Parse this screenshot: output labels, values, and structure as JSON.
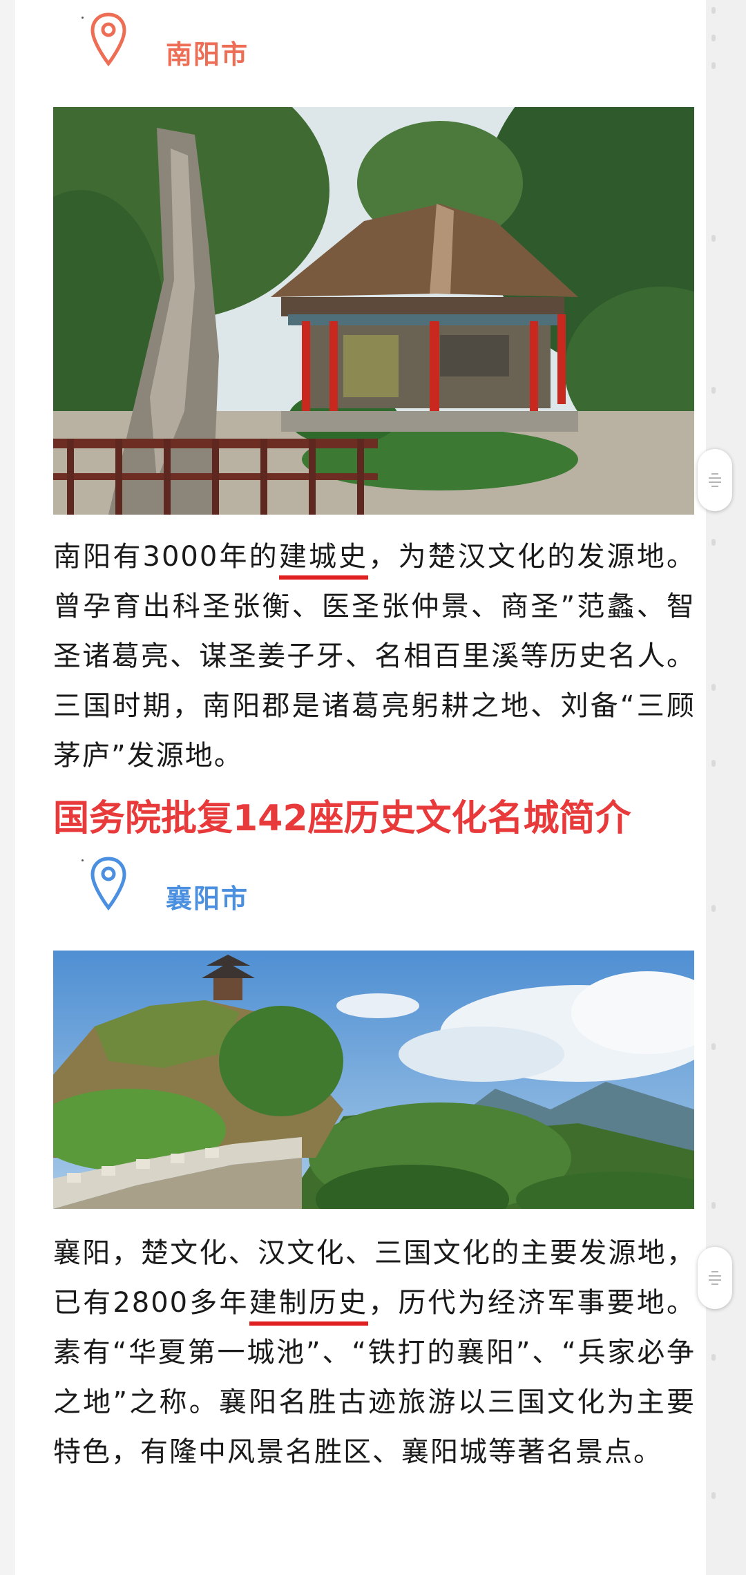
{
  "sections": [
    {
      "city": "南阳市",
      "pin_color": "#ee6e55",
      "paragraph": {
        "part1": "南阳有3000年的",
        "highlight": "建城史",
        "part2": "，为楚汉文化的发源地。曾孕育出科圣张衡、医圣张仲景、商圣”范蠡、智圣诸葛亮、谋圣姜子牙、名相百里溪等历史名人。三国时期，南阳郡是诸葛亮躬耕之地、刘备“三顾茅庐”发源地。"
      }
    },
    {
      "city": "襄阳市",
      "pin_color": "#4a8fe0",
      "paragraph": {
        "part1": "襄阳，楚文化、汉文化、三国文化的主要发源地，已有2800多年",
        "highlight": "建制历史",
        "part2": "，历代为经济军事要地。素有“华夏第一城池”、“铁打的襄阳”、“兵家必争之地”之称。襄阳名胜古迹旅游以三国文化为主要特色，有隆中风景名胜区、襄阳城等著名景点。"
      }
    }
  ],
  "headline": "国务院批复142座历史文化名城简介",
  "colors": {
    "headline": "#e83a3a",
    "underline": "#e02020",
    "nanyang_title": "#ee6e55",
    "xiangyang_title": "#4a8fe0"
  },
  "icons": {
    "pin": "map-pin-icon",
    "handle": "drag-handle-icon"
  }
}
